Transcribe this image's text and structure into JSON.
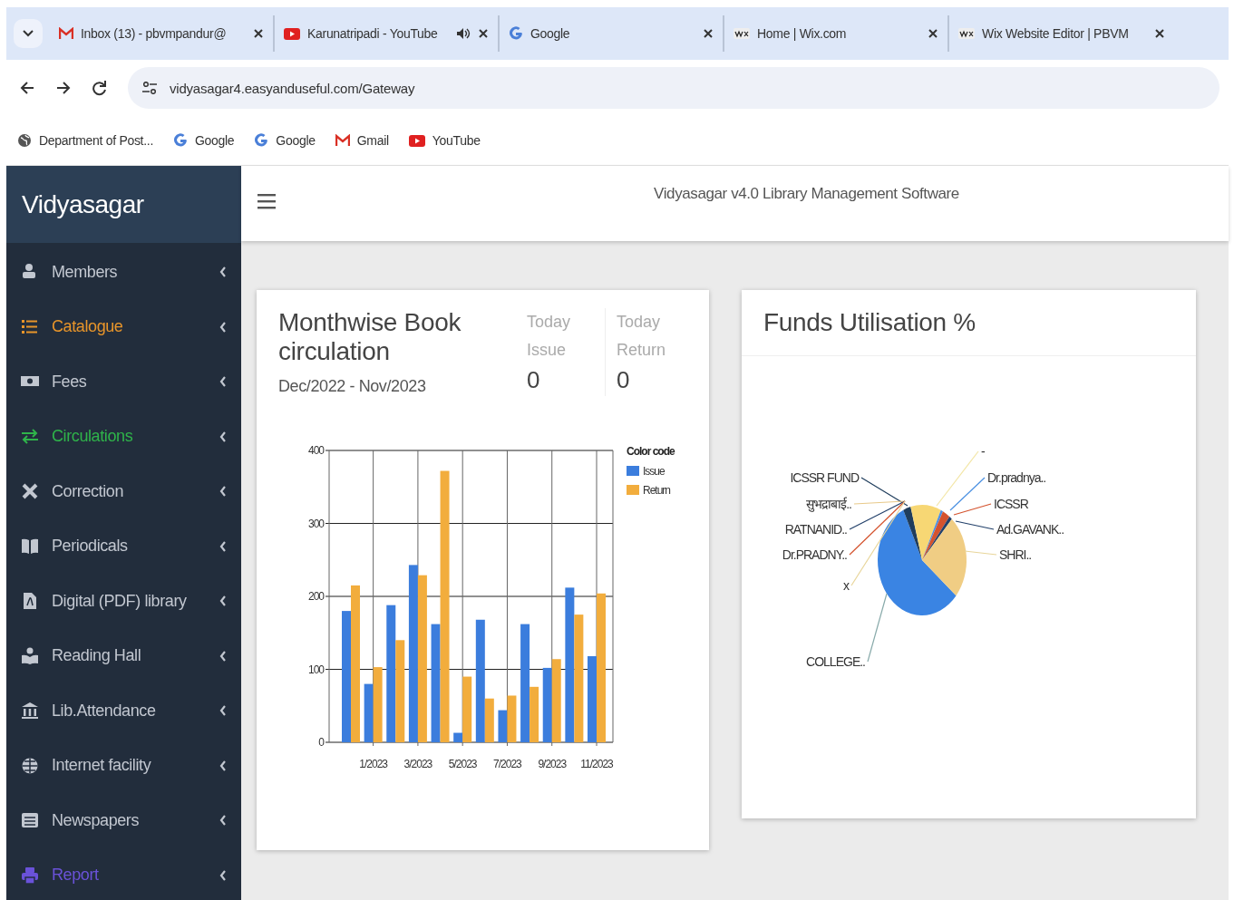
{
  "browser": {
    "tabs": [
      {
        "title": "Inbox (13) - pbvmpandur@",
        "kind": "mail",
        "audio": false
      },
      {
        "title": "Karunatripadi - YouTube",
        "kind": "video",
        "audio": true
      },
      {
        "title": "Google",
        "kind": "search",
        "audio": false
      },
      {
        "title": "Home | Wix.com",
        "kind": "site",
        "audio": false
      },
      {
        "title": "Wix Website Editor | PBVM",
        "kind": "site",
        "audio": false
      }
    ],
    "address": "vidyasagar4.easyanduseful.com/Gateway",
    "bookmarks": [
      {
        "label": "Department of Post...",
        "kind": "globe"
      },
      {
        "label": "Google",
        "kind": "search"
      },
      {
        "label": "Google",
        "kind": "search"
      },
      {
        "label": "Gmail",
        "kind": "mail"
      },
      {
        "label": "YouTube",
        "kind": "video"
      }
    ]
  },
  "app": {
    "brand": "Vidyasagar",
    "title": "Vidyasagar v4.0 Library Management Software"
  },
  "sidebar": {
    "items": [
      {
        "label": "Members",
        "color": "#c2c7d0"
      },
      {
        "label": "Catalogue",
        "color": "#e8952a"
      },
      {
        "label": "Fees",
        "color": "#c2c7d0"
      },
      {
        "label": "Circulations",
        "color": "#2fb44a"
      },
      {
        "label": "Correction",
        "color": "#c2c7d0"
      },
      {
        "label": "Periodicals",
        "color": "#c2c7d0"
      },
      {
        "label": "Digital (PDF) library",
        "color": "#c2c7d0"
      },
      {
        "label": "Reading Hall",
        "color": "#c2c7d0"
      },
      {
        "label": "Lib.Attendance",
        "color": "#c2c7d0"
      },
      {
        "label": "Internet facility",
        "color": "#c2c7d0"
      },
      {
        "label": "Newspapers",
        "color": "#c2c7d0"
      },
      {
        "label": "Report",
        "color": "#6a52d9"
      }
    ]
  },
  "circulation_card": {
    "title": "Monthwise Book circulation",
    "period": "Dec/2022 - Nov/2023",
    "stats": [
      {
        "label": "Today",
        "sublabel": "Issue",
        "value": "0"
      },
      {
        "label": "Today",
        "sublabel": "Return",
        "value": "0"
      }
    ],
    "chart_data": {
      "type": "bar",
      "categories": [
        null,
        "1/2023",
        null,
        "3/2023",
        null,
        "5/2023",
        null,
        "7/2023",
        null,
        "9/2023",
        null,
        "11/2023"
      ],
      "stacked": false,
      "series": [
        {
          "name": "Issue",
          "color": "#3b7ddd",
          "values": [
            180,
            80,
            188,
            243,
            162,
            13,
            168,
            44,
            162,
            102,
            212,
            118
          ]
        },
        {
          "name": "Return",
          "color": "#f2ad3d",
          "values": [
            215,
            103,
            140,
            229,
            372,
            90,
            60,
            64,
            76,
            114,
            175,
            204
          ]
        }
      ],
      "ylim": [
        0,
        400
      ],
      "yticks": [
        0,
        100,
        200,
        300,
        400
      ],
      "grid": true,
      "legend": {
        "title": "Color code"
      }
    }
  },
  "funds_card": {
    "title": "Funds Utilisation %",
    "pie_labels": [
      "-",
      "ICSSR FUND",
      "Dr.pradnya..",
      "सुभद्राबाई..",
      "ICSSR",
      "RATNANID..",
      "Ad.GAVANK..",
      "Dr.PRADNY..",
      "SHRI..",
      "x",
      "COLLEGE.."
    ]
  }
}
